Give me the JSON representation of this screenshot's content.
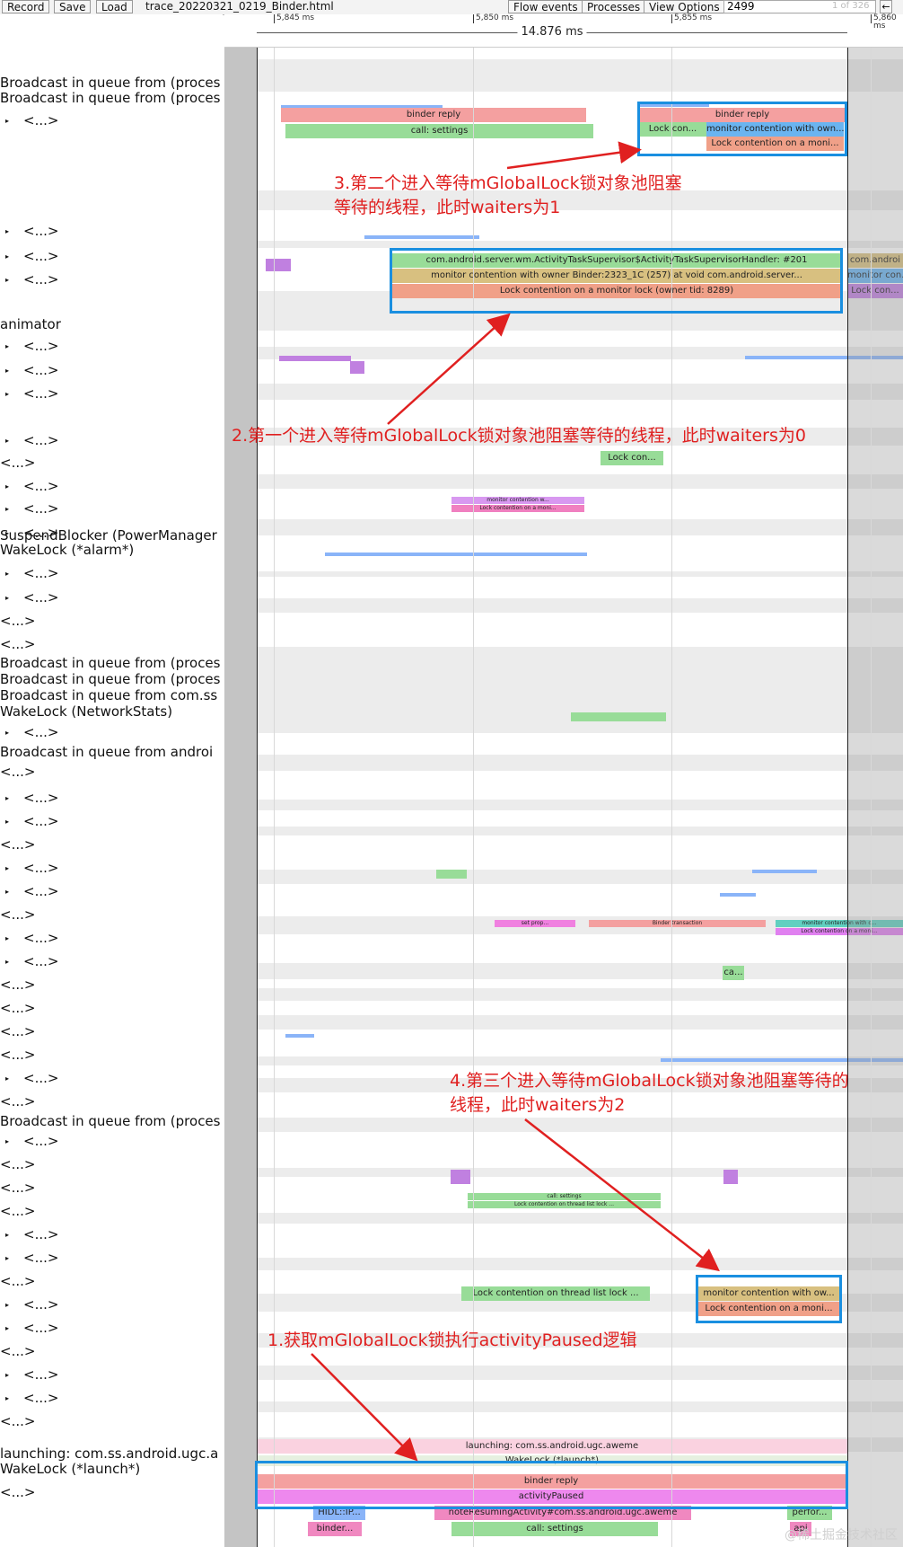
{
  "toolbar": {
    "record": "Record",
    "save": "Save",
    "load": "Load",
    "filename": "trace_20220321_0219_Binder.html",
    "flow_events": "Flow events",
    "processes": "Processes",
    "view_options": "View Options",
    "search_value": "2499",
    "match_count": "1 of 326",
    "prev": "←"
  },
  "ruler": {
    "t1": "5,845 ms",
    "t2": "5,850 ms",
    "t3": "5,855 ms",
    "t4": "5,860 ms",
    "range": "14.876 ms"
  },
  "labels": [
    "Broadcast in queue from (proces",
    "Broadcast in queue from (proces",
    "<...>",
    "<...>",
    "<...>",
    "<...>",
    "animator",
    "<...>",
    "<...>",
    "<...>",
    "<...>",
    "<...>",
    "<...>",
    "<...>",
    "<...>",
    "SuspendBlocker (PowerManager",
    "WakeLock (*alarm*)",
    "<...>",
    "<...>",
    "<...>",
    "<...>",
    "Broadcast in queue from (proces",
    "Broadcast in queue from (proces",
    "Broadcast in queue from com.ss",
    "WakeLock (NetworkStats)",
    "<...>",
    "Broadcast in queue from androi",
    "<...>",
    "<...>",
    "<...>",
    "<...>",
    "<...>",
    "<...>",
    "<...>",
    "<...>",
    "<...>",
    "<...>",
    "<...>",
    "<...>",
    "<...>",
    "<...>",
    "<...>",
    "Broadcast in queue from (proces",
    "<...>",
    "<...>",
    "<...>",
    "<...>",
    "<...>",
    "<...>",
    "<...>",
    "<...>",
    "<...>",
    "<...>",
    "<...>",
    "<...>",
    "<...>",
    "launching: com.ss.android.ugc.a",
    "WakeLock (*launch*)",
    "<...>"
  ],
  "slices": {
    "binder_reply": "binder reply",
    "call_settings": "call: settings",
    "lock_con_short": "Lock con...",
    "monitor_own_short": "monitor contention with own...",
    "lock_moni_short": "Lock contention on a moni...",
    "ats_handler": "com.android.server.wm.ActivityTaskSupervisor$ActivityTaskSupervisorHandler: #201",
    "monitor_owner_binder": "monitor contention with owner Binder:2323_1C (257) at void com.android.server...",
    "lock_owner_tid": "Lock contention on a monitor lock (owner tid: 8289)",
    "com_androi": "com.androi",
    "monitor_con": "monitor con...",
    "lock_con_dots": "Lock con...",
    "tiny_monitor": "monitor contention w...",
    "tiny_lock": "Lock contention on a moni...",
    "set_prop": "set prop...",
    "binder_transaction": "Binder transaction",
    "tiny_monitor2": "monitor contention with o...",
    "tiny_lock2": "Lock contention on a moni...",
    "ca": "ca...",
    "tiny_call_settings": "call: settings",
    "tiny_lock_thread": "Lock contention on thread list lock ...",
    "lock_thread_list": "Lock contention on thread list lock ...",
    "monitor_ow": "monitor contention with ow...",
    "lock_moni": "Lock contention on a moni...",
    "launching": "launching: com.ss.android.ugc.aweme",
    "wakelock_launch": "WakeLock (*launch*)",
    "binder_reply_main": "binder reply",
    "activity_paused": "activityPaused",
    "hidl": "HIDL::IP...",
    "note_resuming": "noteResumingActivity#com.ss.android.ugc.aweme",
    "perfor": "perfor...",
    "binder_dots": "binder...",
    "api": "api",
    "call_settings_bottom": "call: settings"
  },
  "annotations": {
    "note1": "1.获取mGlobalLock锁执行activityPaused逻辑",
    "note2": "2.第一个进入等待mGlobalLock锁对象池阻塞等待的线程，此时waiters为0",
    "note3a": "3.第二个进入等待mGlobalLock锁对象池阻塞",
    "note3b": "等待的线程，此时waiters为1",
    "note4a": "4.第三个进入等待mGlobalLock锁对象池阻塞等待的",
    "note4b": "线程，此时waiters为2"
  },
  "colors": {
    "binder_reply": "#f4a0a0",
    "call_settings": "#98dc98",
    "lock": "#f0a088",
    "monitor_blue": "#6ab4f0",
    "monitor_tan": "#d8c080",
    "activity_paused": "#ee88ee",
    "highlight_box": "#1a8fe0",
    "annotation": "#e02020"
  },
  "watermark": "@稀土掘金技术社区"
}
